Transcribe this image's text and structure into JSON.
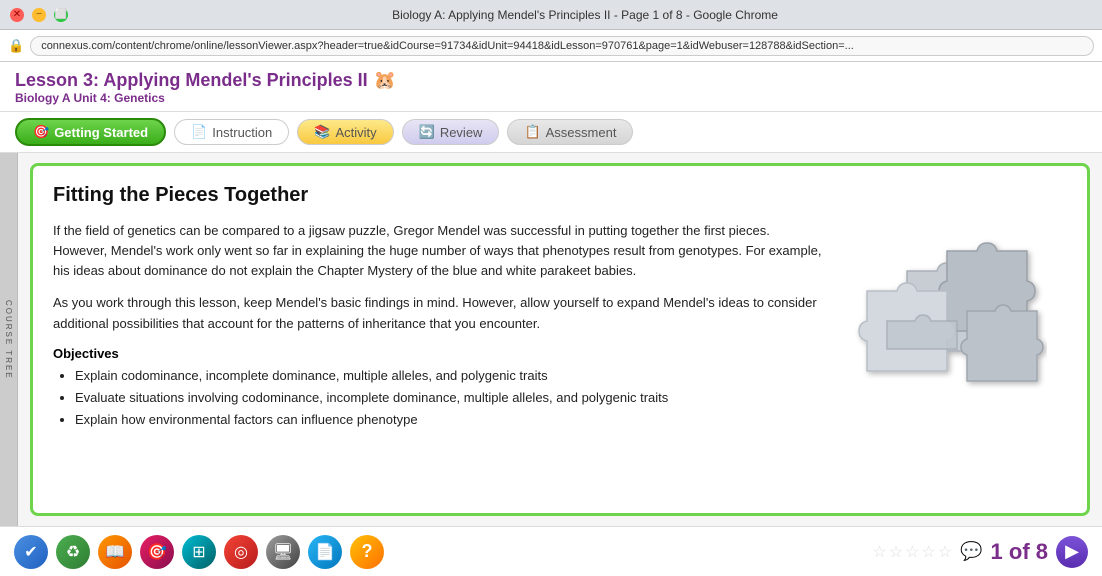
{
  "browser": {
    "title": "Biology A: Applying Mendel's Principles II - Page 1 of 8 - Google Chrome",
    "address": "connexus.com/content/chrome/online/lessonViewer.aspx?header=true&idCourse=91734&idUnit=94418&idLesson=970761&page=1&idWebuser=128788&idSection=..."
  },
  "lesson": {
    "title": "Lesson 3: Applying Mendel's Principles II",
    "subtitle": "Biology A  Unit 4: Genetics"
  },
  "nav_tabs": [
    {
      "label": "Getting Started",
      "style": "active-green",
      "icon": "🎯"
    },
    {
      "label": "Instruction",
      "style": "inactive-white",
      "icon": "📄"
    },
    {
      "label": "Activity",
      "style": "inactive-yellow",
      "icon": "📚"
    },
    {
      "label": "Review",
      "style": "inactive-lavender",
      "icon": "🔄"
    },
    {
      "label": "Assessment",
      "style": "inactive-gray",
      "icon": "📋"
    }
  ],
  "side_label": "COURSE TREE",
  "content": {
    "page_title": "Fitting the Pieces Together",
    "paragraphs": [
      "If the field of genetics can be compared to a jigsaw puzzle, Gregor Mendel was successful in putting together the first pieces. However, Mendel's work only went so far in explaining the huge number of ways that phenotypes result from genotypes. For example, his ideas about dominance do not explain the Chapter Mystery of the blue and white parakeet babies.",
      "As you work through this lesson, keep Mendel's basic findings in mind. However, allow yourself to expand Mendel's ideas to consider additional possibilities that account for the patterns of inheritance that you encounter."
    ],
    "objectives_title": "Objectives",
    "objectives": [
      "Explain codominance, incomplete dominance, multiple alleles, and polygenic traits",
      "Evaluate situations involving codominance, incomplete dominance, multiple alleles, and polygenic traits",
      "Explain how environmental factors can influence phenotype"
    ]
  },
  "bottom_toolbar": {
    "icons": [
      {
        "name": "checkmark",
        "symbol": "✔",
        "color": "icon-blue"
      },
      {
        "name": "recycle",
        "symbol": "♻",
        "color": "icon-green"
      },
      {
        "name": "book",
        "symbol": "📖",
        "color": "icon-orange"
      },
      {
        "name": "target",
        "symbol": "🎯",
        "color": "icon-pink"
      },
      {
        "name": "grid",
        "symbol": "⊞",
        "color": "icon-teal"
      },
      {
        "name": "bullseye",
        "symbol": "◎",
        "color": "icon-red"
      },
      {
        "name": "monitor",
        "symbol": "🖥",
        "color": "icon-gray"
      },
      {
        "name": "document",
        "symbol": "📄",
        "color": "icon-lightblue"
      },
      {
        "name": "question",
        "symbol": "?",
        "color": "icon-yellow"
      }
    ],
    "stars": [
      {
        "filled": false
      },
      {
        "filled": false
      },
      {
        "filled": false
      },
      {
        "filled": false
      },
      {
        "filled": false
      }
    ],
    "page_label": "1 of 8"
  }
}
